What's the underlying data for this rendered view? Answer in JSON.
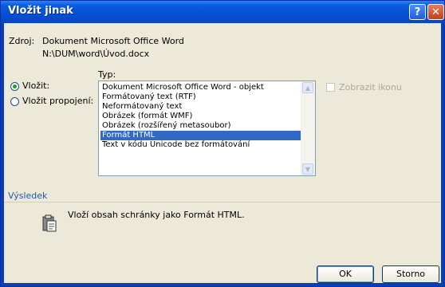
{
  "window": {
    "title": "Vložit jinak",
    "help_label": "?",
    "close_label": "✕"
  },
  "source": {
    "label": "Zdroj:",
    "name": "Dokument Microsoft Office Word",
    "path": "N:\\DUM\\word\\Úvod.docx"
  },
  "type_label": "Typ:",
  "options": [
    {
      "label": "Vložit:",
      "selected": true
    },
    {
      "label": "Vložit propojení:",
      "selected": false
    }
  ],
  "list": {
    "items": [
      "Dokument Microsoft Office Word - objekt",
      "Formátovaný text (RTF)",
      "Neformátovaný text",
      "Obrázek (formát WMF)",
      "Obrázek (rozšířený metasoubor)",
      "Formát HTML",
      "Text v kódu Unicode bez formátování"
    ],
    "selected_index": 5
  },
  "show_icon": {
    "label": "Zobrazit ikonu",
    "checked": false,
    "enabled": false
  },
  "result": {
    "heading": "Výsledek",
    "text": "Vloží obsah schránky jako Formát HTML.",
    "icon": "clipboard-icon"
  },
  "buttons": {
    "ok": "OK",
    "cancel": "Storno"
  },
  "colors": {
    "selection": "#316ac5",
    "titlebar": "#0650d4",
    "face": "#ece9d8"
  }
}
